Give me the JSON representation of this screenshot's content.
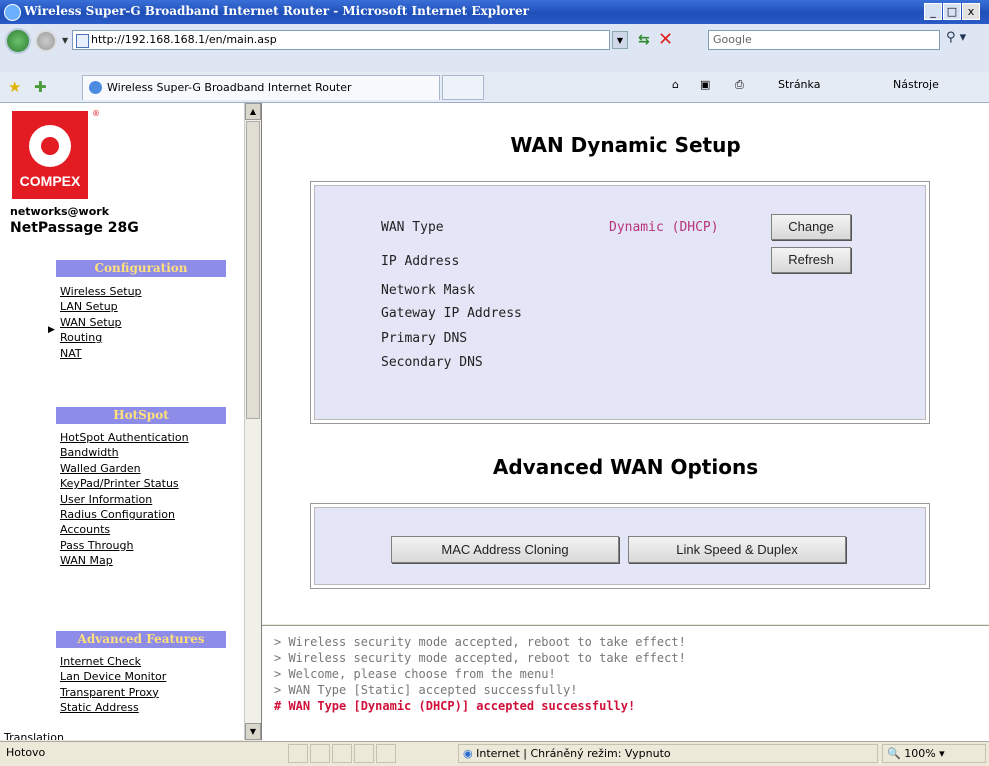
{
  "window": {
    "title": "Wireless Super-G Broadband Internet Router - Microsoft Internet Explorer",
    "min": "_",
    "max": "□",
    "close": "x"
  },
  "address": {
    "url": "http://192.168.168.1/en/main.asp",
    "search_placeholder": "Google"
  },
  "toolbar": {
    "tab_title": "Wireless Super-G Broadband Internet Router",
    "home": "⌂",
    "feeds": "▣",
    "print": "⎙",
    "page_label": "Stránka",
    "tools_label": "Nástroje"
  },
  "sidebar": {
    "logo_text": "COMPEX",
    "tagline": "networks@work",
    "model": "NetPassage 28G",
    "sections": [
      {
        "title": "Configuration",
        "items": [
          "Wireless Setup",
          "LAN Setup",
          "WAN Setup",
          "Routing",
          "NAT"
        ]
      },
      {
        "title": "HotSpot",
        "items": [
          "HotSpot Authentication",
          "Bandwidth",
          "Walled Garden",
          "KeyPad/Printer Status",
          "User Information",
          "Radius Configuration",
          "Accounts",
          "Pass Through",
          "WAN Map"
        ]
      },
      {
        "title": "Advanced Features",
        "items": [
          "Internet Check",
          "Lan Device Monitor",
          "Transparent Proxy",
          "Static Address"
        ]
      }
    ],
    "trailing_text": "Translation"
  },
  "main": {
    "title": "WAN Dynamic Setup",
    "fields": {
      "wan_type_label": "WAN Type",
      "wan_type_value": "Dynamic (DHCP)",
      "ip_label": "IP Address",
      "mask_label": "Network Mask",
      "gateway_label": "Gateway IP Address",
      "dns1_label": "Primary DNS",
      "dns2_label": "Secondary DNS"
    },
    "change_button": "Change",
    "refresh_button": "Refresh",
    "advanced_title": "Advanced WAN Options",
    "mac_button": "MAC Address Cloning",
    "link_button": "Link Speed & Duplex"
  },
  "console": {
    "lines": [
      "> Wireless security mode accepted, reboot to take effect!",
      "> Wireless security mode accepted, reboot to take effect!",
      "> Welcome, please choose from the menu!",
      "> WAN Type [Static] accepted successfully!",
      "# WAN Type [Dynamic (DHCP)] accepted successfully!"
    ]
  },
  "statusbar": {
    "left": "Hotovo",
    "zone": "Internet | Chráněný režim: Vypnuto",
    "zoom": "100%"
  }
}
